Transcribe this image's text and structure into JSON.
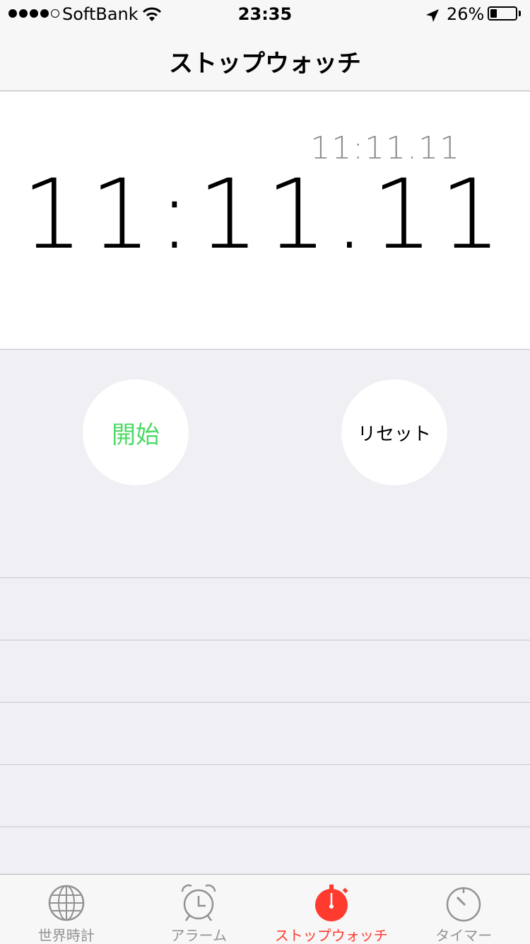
{
  "status_bar": {
    "carrier": "SoftBank",
    "time": "23:35",
    "battery_percent": "26%",
    "battery_level": 0.26,
    "signal_bars_filled": 4,
    "signal_bars_total": 5
  },
  "nav": {
    "title": "ストップウォッチ"
  },
  "stopwatch": {
    "lap_time": "11:11.11",
    "main_time": "11:11.11"
  },
  "controls": {
    "start_label": "開始",
    "reset_label": "リセット",
    "start_color": "#4cd964"
  },
  "laps": [
    "",
    "",
    "",
    "",
    ""
  ],
  "tabs": [
    {
      "label": "世界時計",
      "icon": "globe-icon",
      "active": false
    },
    {
      "label": "アラーム",
      "icon": "alarm-clock-icon",
      "active": false
    },
    {
      "label": "ストップウォッチ",
      "icon": "stopwatch-icon",
      "active": true
    },
    {
      "label": "タイマー",
      "icon": "timer-icon",
      "active": false
    }
  ],
  "colors": {
    "accent": "#ff3b30",
    "inactive": "#929292",
    "background": "#efeff4"
  }
}
